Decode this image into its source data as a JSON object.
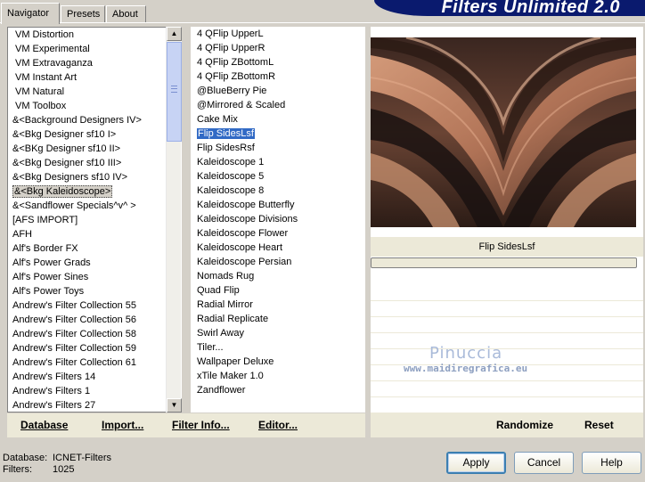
{
  "tabs": [
    "Navigator",
    "Presets",
    "About"
  ],
  "banner_title": "Filters Unlimited 2.0",
  "categories": [
    "VM Distortion",
    "VM Experimental",
    "VM Extravaganza",
    "VM Instant Art",
    "VM Natural",
    "VM Toolbox",
    "&<Background Designers IV>",
    "&<Bkg Designer sf10 I>",
    "&<BKg Designer sf10 II>",
    "&<Bkg Designer sf10 III>",
    "&<Bkg Designers sf10 IV>",
    "&<Bkg Kaleidoscope>",
    "&<Sandflower Specials^v^ >",
    "[AFS IMPORT]",
    "AFH",
    "Alf's Border FX",
    "Alf's Power Grads",
    "Alf's Power Sines",
    "Alf's Power Toys",
    "Andrew's Filter Collection 55",
    "Andrew's Filter Collection 56",
    "Andrew's Filter Collection 58",
    "Andrew's Filter Collection 59",
    "Andrew's Filter Collection 61",
    "Andrew's Filters 14",
    "Andrew's Filters 1",
    "Andrew's Filters 27"
  ],
  "filters": [
    "4 QFlip UpperL",
    "4 QFlip UpperR",
    "4 QFlip ZBottomL",
    "4 QFlip ZBottomR",
    "@BlueBerry Pie",
    "@Mirrored & Scaled",
    "Cake Mix",
    "Flip SidesLsf",
    "Flip SidesRsf",
    "Kaleidoscope 1",
    "Kaleidoscope 5",
    "Kaleidoscope 8",
    "Kaleidoscope Butterfly",
    "Kaleidoscope Divisions",
    "Kaleidoscope Flower",
    "Kaleidoscope Heart",
    "Kaleidoscope Persian",
    "Nomads Rug",
    "Quad Flip",
    "Radial Mirror",
    "Radial Replicate",
    "Swirl Away",
    "Tiler...",
    "Wallpaper Deluxe",
    "xTile Maker 1.0",
    "Zandflower"
  ],
  "selected_filter_name": "Flip SidesLsf",
  "watermark": {
    "name": "Pinuccia",
    "url": "www.maidiregrafica.eu"
  },
  "left_buttons": {
    "database": "Database",
    "import": "Import...",
    "filter_info": "Filter Info...",
    "editor": "Editor..."
  },
  "right_buttons": {
    "randomize": "Randomize",
    "reset": "Reset"
  },
  "status": {
    "db_label": "Database:",
    "db_value": "ICNET-Filters",
    "filters_label": "Filters:",
    "filters_value": "1025"
  },
  "dialog": {
    "apply": "Apply",
    "cancel": "Cancel",
    "help": "Help"
  },
  "colors": {
    "selection": "#316ac5",
    "banner": "#0a1a6e",
    "preview_copper": "#c98d6a"
  }
}
